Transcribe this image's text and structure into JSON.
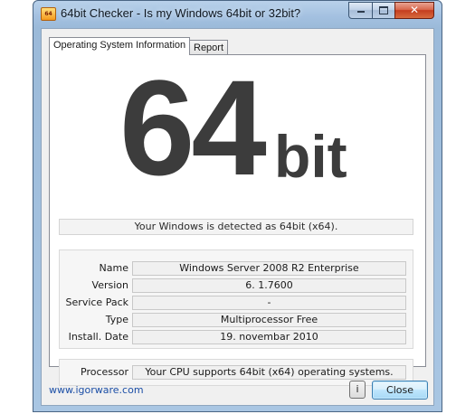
{
  "window": {
    "title": "64bit Checker - Is my Windows 64bit or 32bit?",
    "icon_name": "app-64bit-icon",
    "accent": "#9bbad9"
  },
  "tabs": [
    {
      "label": "Operating System Information",
      "active": true
    },
    {
      "label": "Report",
      "active": false
    }
  ],
  "hero": {
    "number": "64",
    "suffix": "bit"
  },
  "detection_text": "Your Windows is detected as 64bit (x64).",
  "info": [
    {
      "label": "Name",
      "value": "Windows Server 2008 R2 Enterprise"
    },
    {
      "label": "Version",
      "value": "6. 1.7600"
    },
    {
      "label": "Service Pack",
      "value": "-"
    },
    {
      "label": "Type",
      "value": "Multiprocessor Free"
    },
    {
      "label": "Install. Date",
      "value": "19. novembar 2010"
    }
  ],
  "processor": {
    "label": "Processor",
    "value": "Your CPU supports 64bit (x64) operating systems."
  },
  "footer": {
    "link": "www.igorware.com",
    "info_button": "i",
    "close_button": "Close"
  }
}
